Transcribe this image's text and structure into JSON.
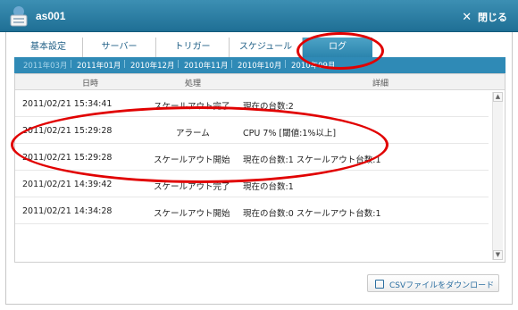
{
  "window": {
    "title": "as001",
    "close_label": "閉じる",
    "close_symbol": "✕"
  },
  "tabs": [
    "基本設定",
    "サーバー",
    "トリガー",
    "スケジュール",
    "ログ"
  ],
  "months": [
    "2011年03月",
    "2011年01月",
    "2010年12月",
    "2010年11月",
    "2010年10月",
    "2010年09月"
  ],
  "table": {
    "headers": [
      "日時",
      "処理",
      "詳細"
    ],
    "rows": [
      {
        "datetime": "2011/02/21 15:34:41",
        "action": "スケールアウト完了",
        "detail": "現在の台数:2"
      },
      {
        "datetime": "2011/02/21 15:29:28",
        "action": "アラーム",
        "detail": "CPU 7% [閾値:1%以上]"
      },
      {
        "datetime": "2011/02/21 15:29:28",
        "action": "スケールアウト開始",
        "detail": "現在の台数:1 スケールアウト台数:1"
      },
      {
        "datetime": "2011/02/21 14:39:42",
        "action": "スケールアウト完了",
        "detail": "現在の台数:1"
      },
      {
        "datetime": "2011/02/21 14:34:28",
        "action": "スケールアウト開始",
        "detail": "現在の台数:0 スケールアウト台数:1"
      }
    ]
  },
  "csv_button_label": "CSVファイルをダウンロード"
}
